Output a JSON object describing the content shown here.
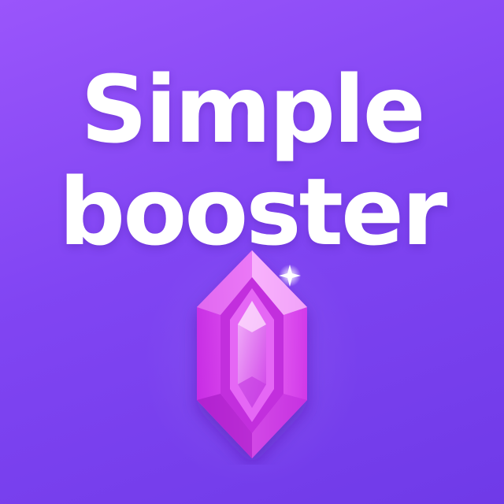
{
  "title": {
    "line1": "Simple",
    "line2": "booster"
  },
  "colors": {
    "background_light": "#9a55fb",
    "background_dark": "#6f3ae8",
    "text": "#ffffff",
    "gem_main": "#e040f0",
    "gem_light": "#f59af8",
    "gem_dark": "#b01fd0"
  },
  "icons": {
    "gem": "gem-icon"
  }
}
